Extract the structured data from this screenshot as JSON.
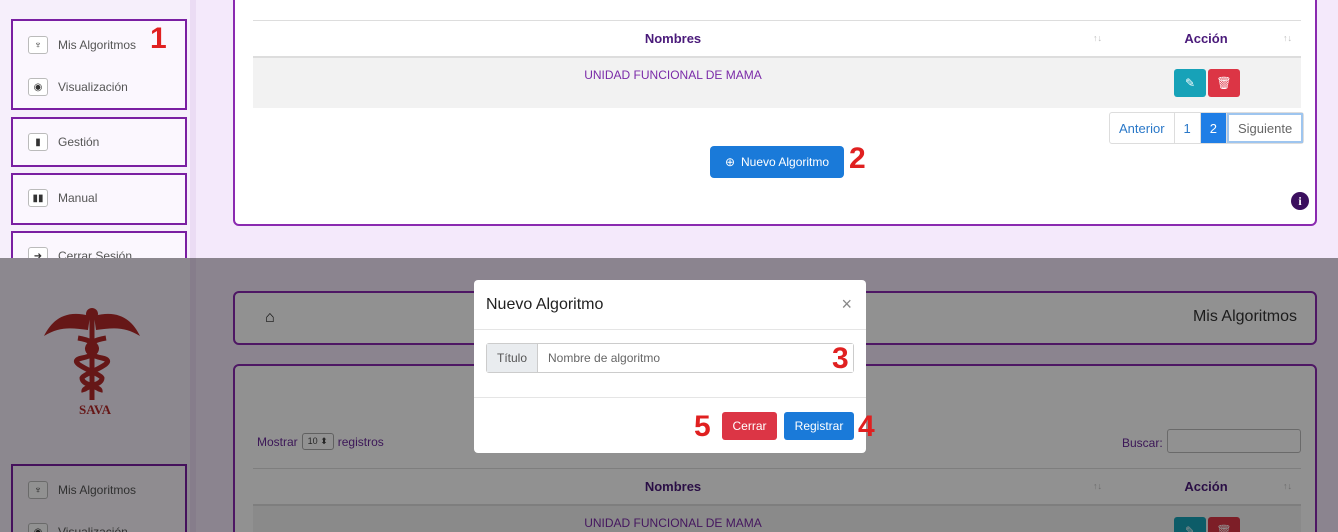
{
  "sidebar": {
    "brand": "SAVA",
    "items": [
      {
        "label": "Mis Algoritmos",
        "icon": "stethoscope-icon"
      },
      {
        "label": "Visualización",
        "icon": "eye-icon"
      },
      {
        "label": "Gestión",
        "icon": "id-card-icon"
      },
      {
        "label": "Manual",
        "icon": "book-icon"
      },
      {
        "label": "Cerrar Sesión",
        "icon": "sign-out-icon"
      }
    ]
  },
  "breadcrumb": {
    "title": "Mis Algoritmos"
  },
  "table": {
    "show_label_prefix": "Mostrar",
    "show_value": "10",
    "show_label_suffix": "registros",
    "search_label": "Buscar:",
    "headers": {
      "nombres": "Nombres",
      "accion": "Acción"
    },
    "rows": [
      {
        "nombre": "UNIDAD FUNCIONAL DE MAMA"
      }
    ]
  },
  "pagination": {
    "prev": "Anterior",
    "pages": [
      "1",
      "2"
    ],
    "current": "2",
    "next": "Siguiente"
  },
  "new_button": "Nuevo Algoritmo",
  "modal": {
    "title": "Nuevo Algoritmo",
    "close_symbol": "×",
    "field_label": "Título",
    "field_placeholder": "Nombre de algoritmo",
    "cancel": "Cerrar",
    "submit": "Registrar"
  },
  "annotations": [
    "1",
    "2",
    "3",
    "4",
    "5"
  ],
  "colors": {
    "accent_purple": "#8a2ab0",
    "primary_blue": "#1a7ad9",
    "danger_red": "#dc3545",
    "info_teal": "#17a2b8",
    "annotation_red": "#e02020"
  }
}
